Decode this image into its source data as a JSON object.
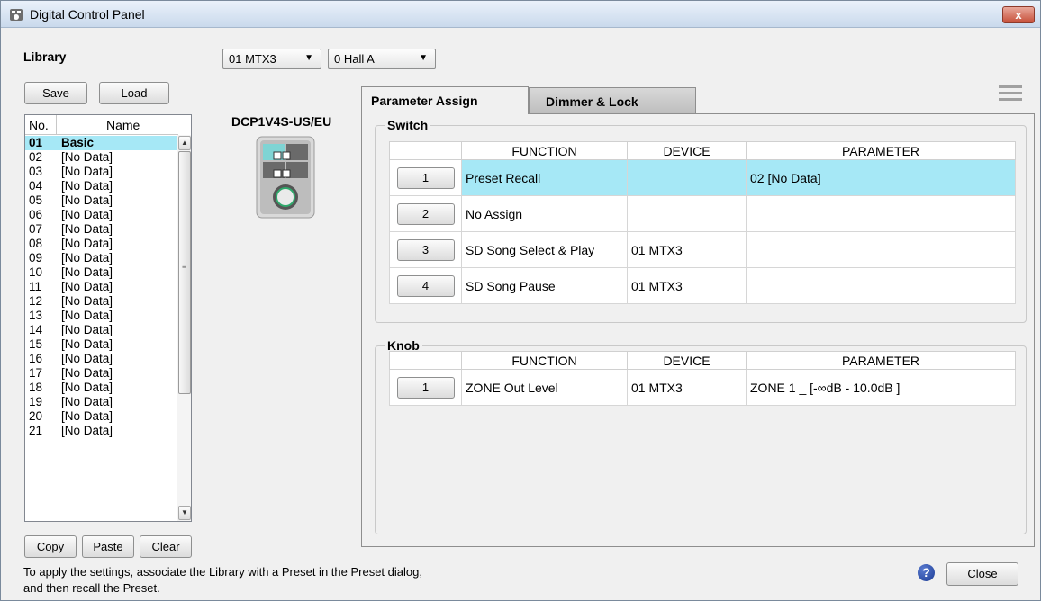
{
  "window": {
    "title": "Digital Control Panel",
    "close_symbol": "x"
  },
  "library": {
    "label": "Library",
    "save_label": "Save",
    "load_label": "Load",
    "columns": [
      "No.",
      "Name"
    ],
    "rows": [
      {
        "no": "01",
        "name": "Basic",
        "selected": true
      },
      {
        "no": "02",
        "name": "[No Data]"
      },
      {
        "no": "03",
        "name": "[No Data]"
      },
      {
        "no": "04",
        "name": "[No Data]"
      },
      {
        "no": "05",
        "name": "[No Data]"
      },
      {
        "no": "06",
        "name": "[No Data]"
      },
      {
        "no": "07",
        "name": "[No Data]"
      },
      {
        "no": "08",
        "name": "[No Data]"
      },
      {
        "no": "09",
        "name": "[No Data]"
      },
      {
        "no": "10",
        "name": "[No Data]"
      },
      {
        "no": "11",
        "name": "[No Data]"
      },
      {
        "no": "12",
        "name": "[No Data]"
      },
      {
        "no": "13",
        "name": "[No Data]"
      },
      {
        "no": "14",
        "name": "[No Data]"
      },
      {
        "no": "15",
        "name": "[No Data]"
      },
      {
        "no": "16",
        "name": "[No Data]"
      },
      {
        "no": "17",
        "name": "[No Data]"
      },
      {
        "no": "18",
        "name": "[No Data]"
      },
      {
        "no": "19",
        "name": "[No Data]"
      },
      {
        "no": "20",
        "name": "[No Data]"
      },
      {
        "no": "21",
        "name": "[No Data]"
      }
    ],
    "copy_label": "Copy",
    "paste_label": "Paste",
    "clear_label": "Clear"
  },
  "selectors": {
    "device": "01 MTX3",
    "location": "0 Hall A"
  },
  "model": {
    "name": "DCP1V4S-US/EU"
  },
  "tabs": [
    {
      "label": "Parameter Assign",
      "active": true
    },
    {
      "label": "Dimmer & Lock",
      "active": false
    }
  ],
  "switch": {
    "title": "Switch",
    "headers": [
      "FUNCTION",
      "DEVICE",
      "PARAMETER"
    ],
    "rows": [
      {
        "button": "1",
        "function": "Preset Recall",
        "device": "",
        "parameter": "02 [No Data]",
        "highlight": true
      },
      {
        "button": "2",
        "function": "No Assign",
        "device": "",
        "parameter": ""
      },
      {
        "button": "3",
        "function": "SD Song Select & Play",
        "device": "01 MTX3",
        "parameter": ""
      },
      {
        "button": "4",
        "function": "SD Song Pause",
        "device": "01 MTX3",
        "parameter": ""
      }
    ]
  },
  "knob": {
    "title": "Knob",
    "headers": [
      "FUNCTION",
      "DEVICE",
      "PARAMETER"
    ],
    "rows": [
      {
        "button": "1",
        "function": "ZONE Out Level",
        "device": "01 MTX3",
        "parameter": "ZONE 1 _ [-∞dB - 10.0dB ]"
      }
    ]
  },
  "footer": {
    "line1": "To apply the settings, associate the Library with a Preset in the Preset dialog,",
    "line2": "and then recall the Preset.",
    "close_label": "Close",
    "help_symbol": "?"
  },
  "colors": {
    "selection": "#a6e8f6",
    "title_bar": "#c9d9ec",
    "close_red": "#c7503a"
  }
}
